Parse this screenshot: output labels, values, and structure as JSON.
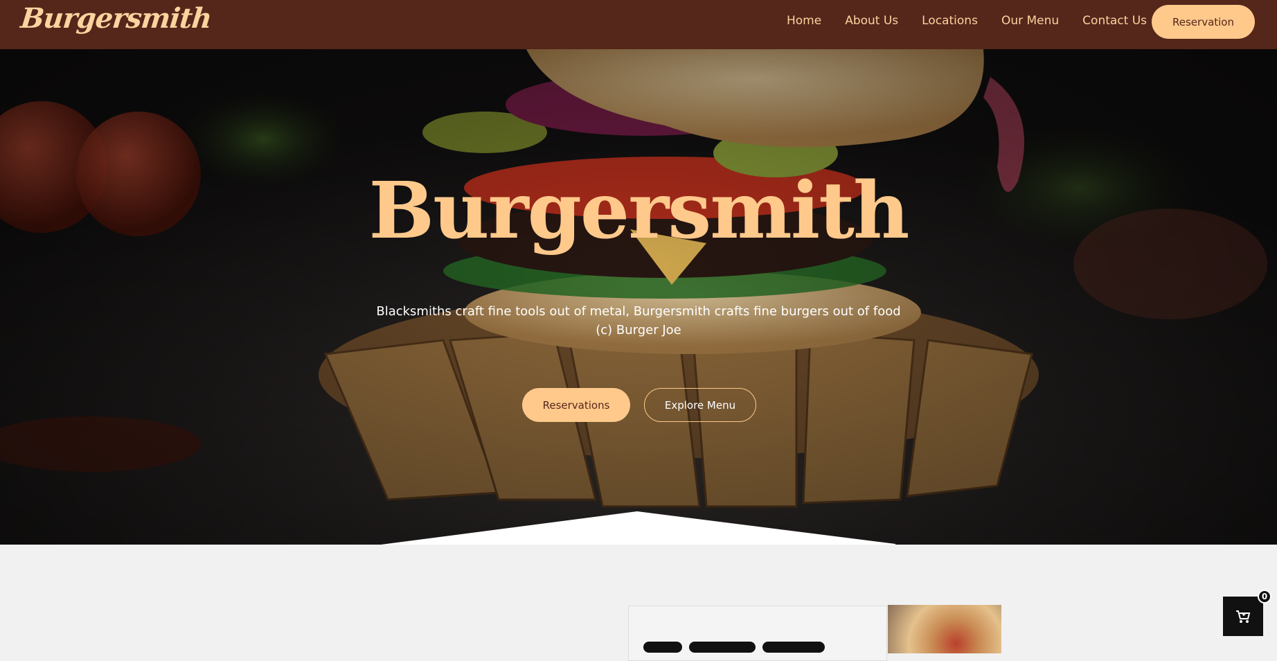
{
  "brand": {
    "logo_text": "Burgersmith"
  },
  "nav": {
    "links": [
      "Home",
      "About Us",
      "Locations",
      "Our Menu",
      "Contact Us"
    ],
    "cta_label": "Reservation"
  },
  "hero": {
    "title": "Burgersmith",
    "quote_line1": "Blacksmiths craft fine tools out of metal, Burgersmith crafts fine burgers out of food",
    "quote_line2": "(c) Burger Joe",
    "primary_button": "Reservations",
    "secondary_button": "Explore Menu"
  },
  "cart": {
    "count": "0",
    "icon": "cart-icon"
  },
  "colors": {
    "brand_brown": "#55261a",
    "accent_peach": "#fec98b",
    "background": "#f1f1f1"
  }
}
